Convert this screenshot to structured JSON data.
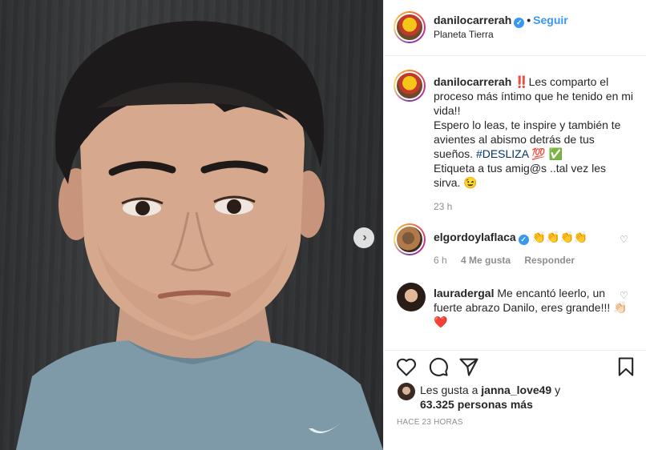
{
  "post": {
    "username": "danilocarrerah",
    "follow_label": "Seguir",
    "location": "Planeta Tierra"
  },
  "caption": {
    "username": "danilocarrerah",
    "text_1": "‼️Les comparto el proceso más íntimo que he tenido en mi vida!!",
    "text_2": "Espero lo leas, te inspire y también te avientes al abismo detrás de tus sueños. ",
    "hashtag": "#DESLIZA",
    "emoji_after_hashtag": " 💯 ✅",
    "text_3": "Etiqueta a tus amig@s ..tal vez les sirva. 😉",
    "time": "23 h"
  },
  "comments": [
    {
      "username": "elgordoylaflaca",
      "text": "👏👏👏👏",
      "time": "6 h",
      "likes": "4 Me gusta",
      "reply": "Responder"
    },
    {
      "username": "lauradergal",
      "text": "Me encantó leerlo, un fuerte abrazo Danilo, eres grande!!! 👏🏻❤️"
    }
  ],
  "likes": {
    "prefix": "Les gusta a ",
    "user": "janna_love49",
    "conj": " y",
    "count": "63.325 personas más"
  },
  "timestamp": "HACE 23 HORAS",
  "icons": [
    "heart-icon",
    "comment-icon",
    "share-icon",
    "bookmark-icon",
    "chevron-right-icon",
    "verified-icon"
  ],
  "colors": {
    "accent": "#3897f0",
    "verified": "#3897f0",
    "muted": "#8e8e8e"
  }
}
